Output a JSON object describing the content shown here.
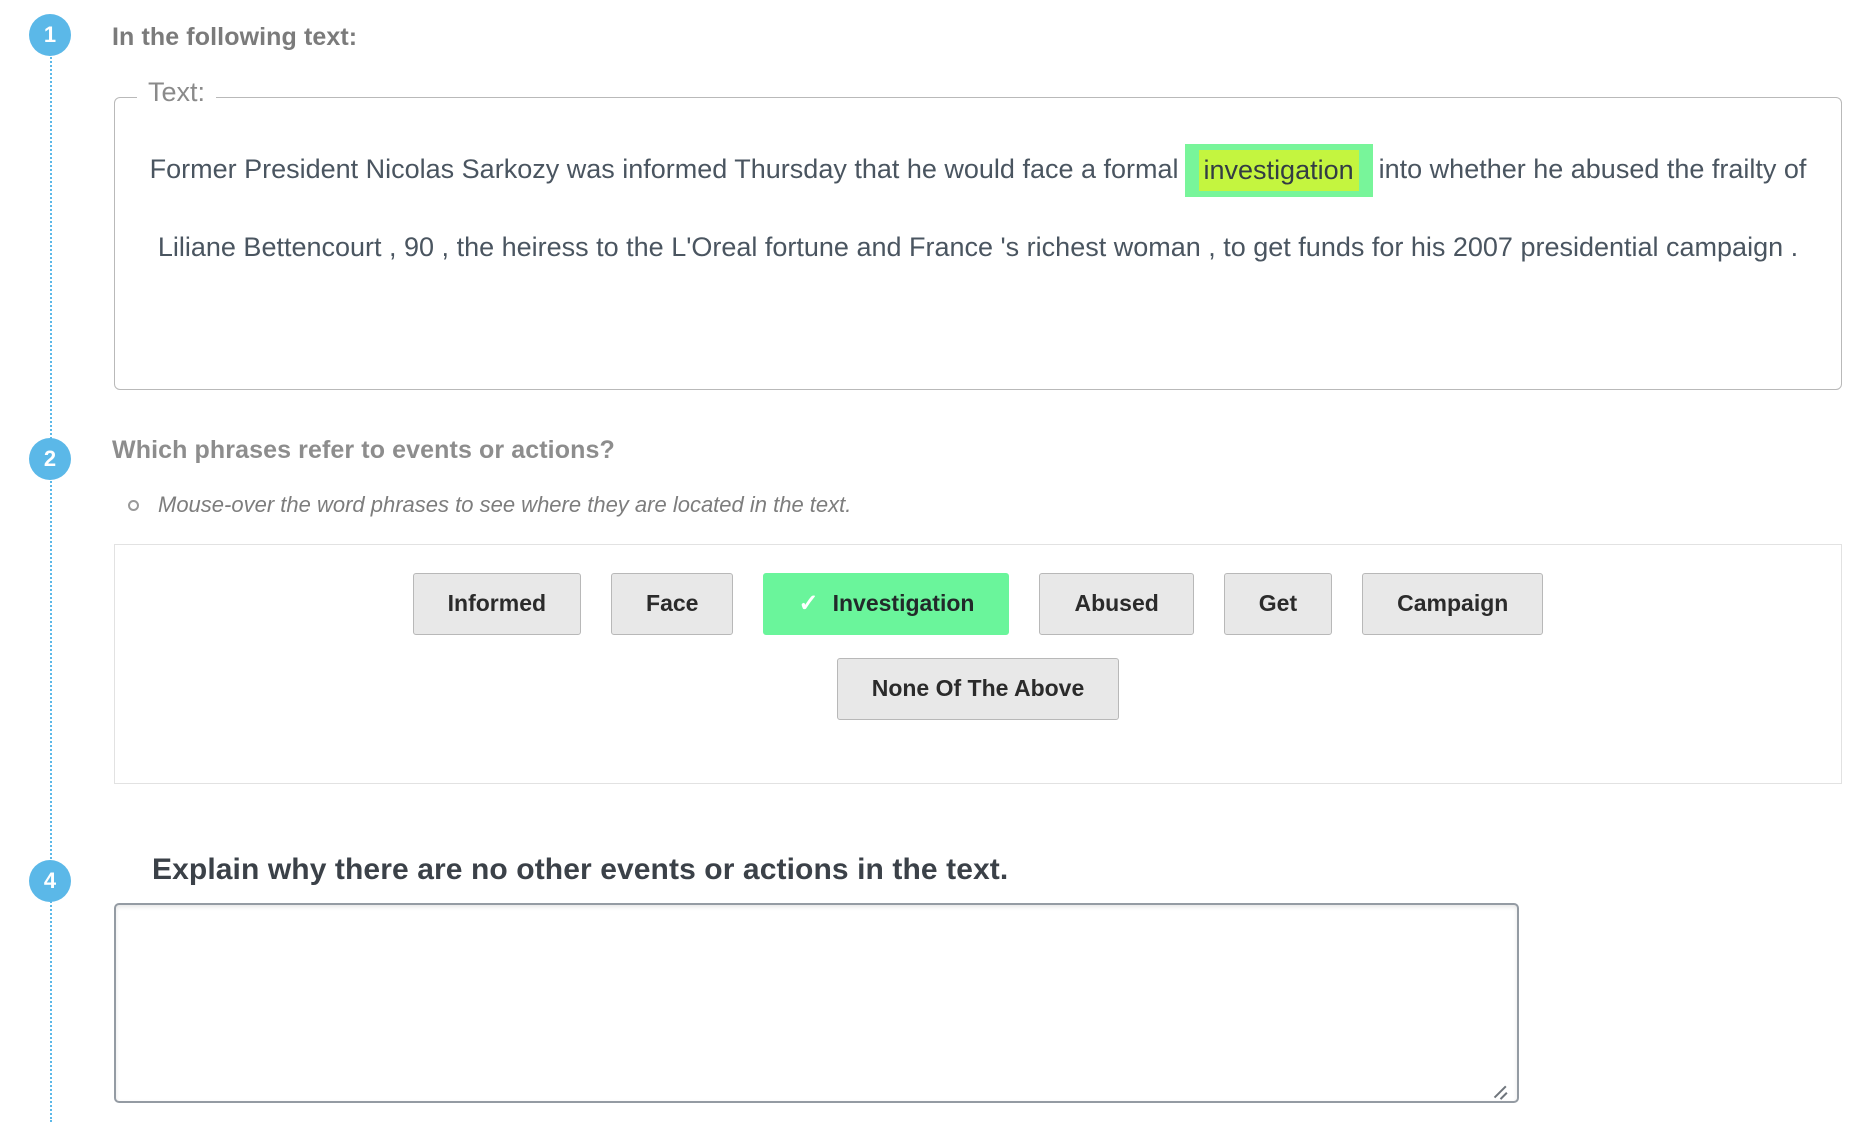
{
  "steps": {
    "one": "1",
    "two": "2",
    "four": "4"
  },
  "section1": {
    "title": "In the following text:",
    "fieldset_legend": "Text:",
    "text_before": "Former President Nicolas Sarkozy was informed Thursday that he would face a formal",
    "highlighted_word": "investigation",
    "text_after": "into whether he abused the frailty of Liliane Bettencourt , 90 , the heiress to the L'Oreal fortune and France 's richest woman , to get funds for his 2007 presidential campaign ."
  },
  "section2": {
    "title": "Which phrases refer to events or actions?",
    "hint": "Mouse-over the word phrases to see where they are located in the text.",
    "hint_bullet_icon": "circle-outline-icon",
    "check_icon": "check-icon",
    "choices_row1": [
      {
        "label": "Informed",
        "selected": false
      },
      {
        "label": "Face",
        "selected": false
      },
      {
        "label": "Investigation",
        "selected": true
      },
      {
        "label": "Abused",
        "selected": false
      },
      {
        "label": "Get",
        "selected": false
      },
      {
        "label": "Campaign",
        "selected": false
      }
    ],
    "choices_row2": [
      {
        "label": "None Of The Above",
        "selected": false
      }
    ]
  },
  "section4": {
    "title": "Explain why there are no other events or actions in the text.",
    "answer_value": "",
    "answer_placeholder": "",
    "resize_handle_icon": "resize-handle-icon"
  },
  "colors": {
    "step_badge": "#5BB8E8",
    "selected_chip": "#6af59b",
    "highlight_outer": "#78f59a",
    "highlight_inner": "#c4f53f",
    "chip_bg": "#e8e8e8"
  }
}
